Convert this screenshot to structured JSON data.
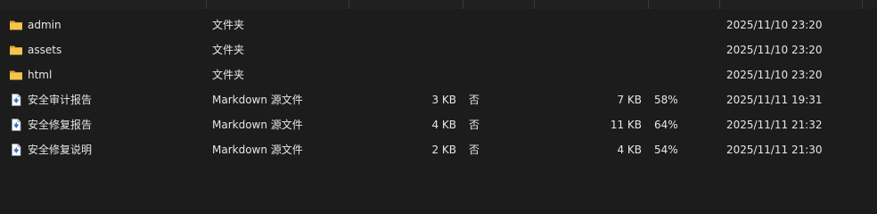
{
  "files": [
    {
      "icon": "folder-icon",
      "name": "admin",
      "type": "文件夹",
      "size": "",
      "flag": "",
      "original_size": "",
      "ratio": "",
      "date": "2025/11/10 23:20"
    },
    {
      "icon": "folder-icon",
      "name": "assets",
      "type": "文件夹",
      "size": "",
      "flag": "",
      "original_size": "",
      "ratio": "",
      "date": "2025/11/10 23:20"
    },
    {
      "icon": "folder-icon",
      "name": "html",
      "type": "文件夹",
      "size": "",
      "flag": "",
      "original_size": "",
      "ratio": "",
      "date": "2025/11/10 23:20"
    },
    {
      "icon": "markdown-file-icon",
      "name": "安全审计报告",
      "type": "Markdown 源文件",
      "size": "3 KB",
      "flag": "否",
      "original_size": "7 KB",
      "ratio": "58%",
      "date": "2025/11/11 19:31"
    },
    {
      "icon": "markdown-file-icon",
      "name": "安全修复报告",
      "type": "Markdown 源文件",
      "size": "4 KB",
      "flag": "否",
      "original_size": "11 KB",
      "ratio": "64%",
      "date": "2025/11/11 21:32"
    },
    {
      "icon": "markdown-file-icon",
      "name": "安全修复说明",
      "type": "Markdown 源文件",
      "size": "2 KB",
      "flag": "否",
      "original_size": "4 KB",
      "ratio": "54%",
      "date": "2025/11/11 21:30"
    }
  ],
  "colors": {
    "background": "#1c1c1c",
    "text": "#e6e6e6",
    "folder": "#f4c44e",
    "file_accent": "#2f6fd6"
  }
}
